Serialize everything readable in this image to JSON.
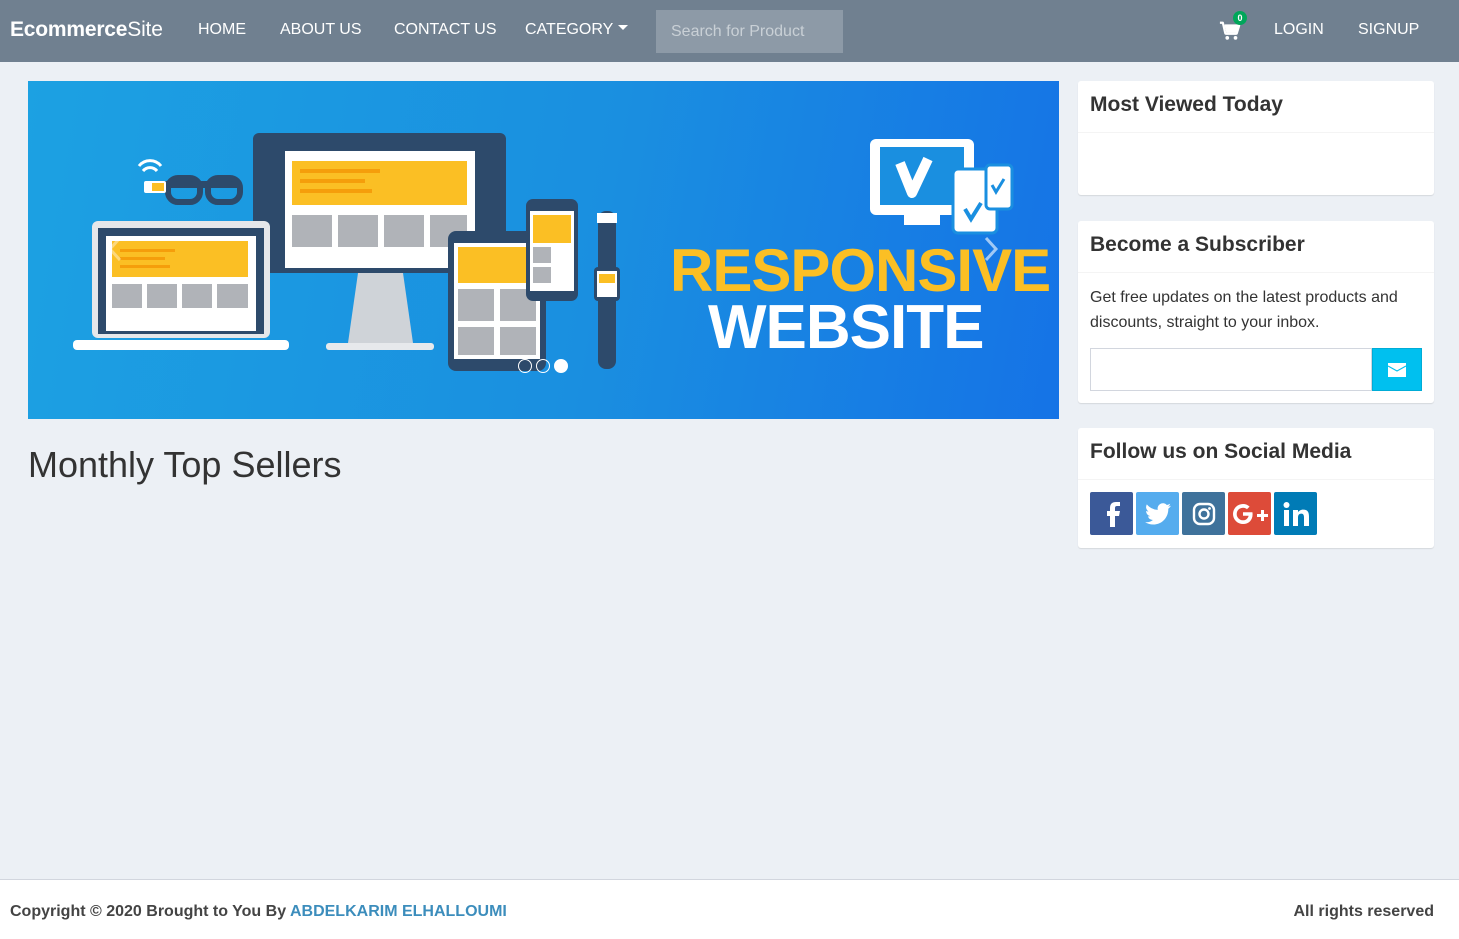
{
  "navbar": {
    "brand_bold": "Ecommerce",
    "brand_rest": "Site",
    "links": {
      "home": "HOME",
      "about": "ABOUT US",
      "contact": "CONTACT US",
      "category": "CATEGORY",
      "login": "LOGIN",
      "signup": "SIGNUP"
    },
    "search": {
      "placeholder": "Search for Product",
      "value": ""
    },
    "cart": {
      "icon": "shopping-cart-icon",
      "count": "0",
      "badge_color": "#00a65a"
    },
    "background": "#708090"
  },
  "carousel": {
    "headline_line1": "RESPONSIVE",
    "headline_line2": "WEBSITE",
    "slide_count": 3,
    "active_slide": 3,
    "prev_icon": "chevron-left-icon",
    "next_icon": "chevron-right-icon"
  },
  "main": {
    "section_title": "Monthly Top Sellers"
  },
  "sidebar": {
    "most_viewed": {
      "title": "Most Viewed Today"
    },
    "subscriber": {
      "title": "Become a Subscriber",
      "description": "Get free updates on the latest products and discounts, straight to your inbox.",
      "email_value": "",
      "button_icon": "envelope-icon",
      "button_color": "#00c0ef"
    },
    "social": {
      "title": "Follow us on Social Media",
      "networks": [
        {
          "name": "facebook-icon",
          "color": "#3b5998"
        },
        {
          "name": "twitter-icon",
          "color": "#55acee"
        },
        {
          "name": "instagram-icon",
          "color": "#3f729b"
        },
        {
          "name": "google-plus-icon",
          "color": "#dd4b39"
        },
        {
          "name": "linkedin-icon",
          "color": "#007bb6"
        }
      ]
    }
  },
  "footer": {
    "copyright_prefix": "Copyright © 2020 Brought to You By",
    "author": "ABDELKARIM ELHALLOUMI",
    "rights": "All rights reserved"
  }
}
